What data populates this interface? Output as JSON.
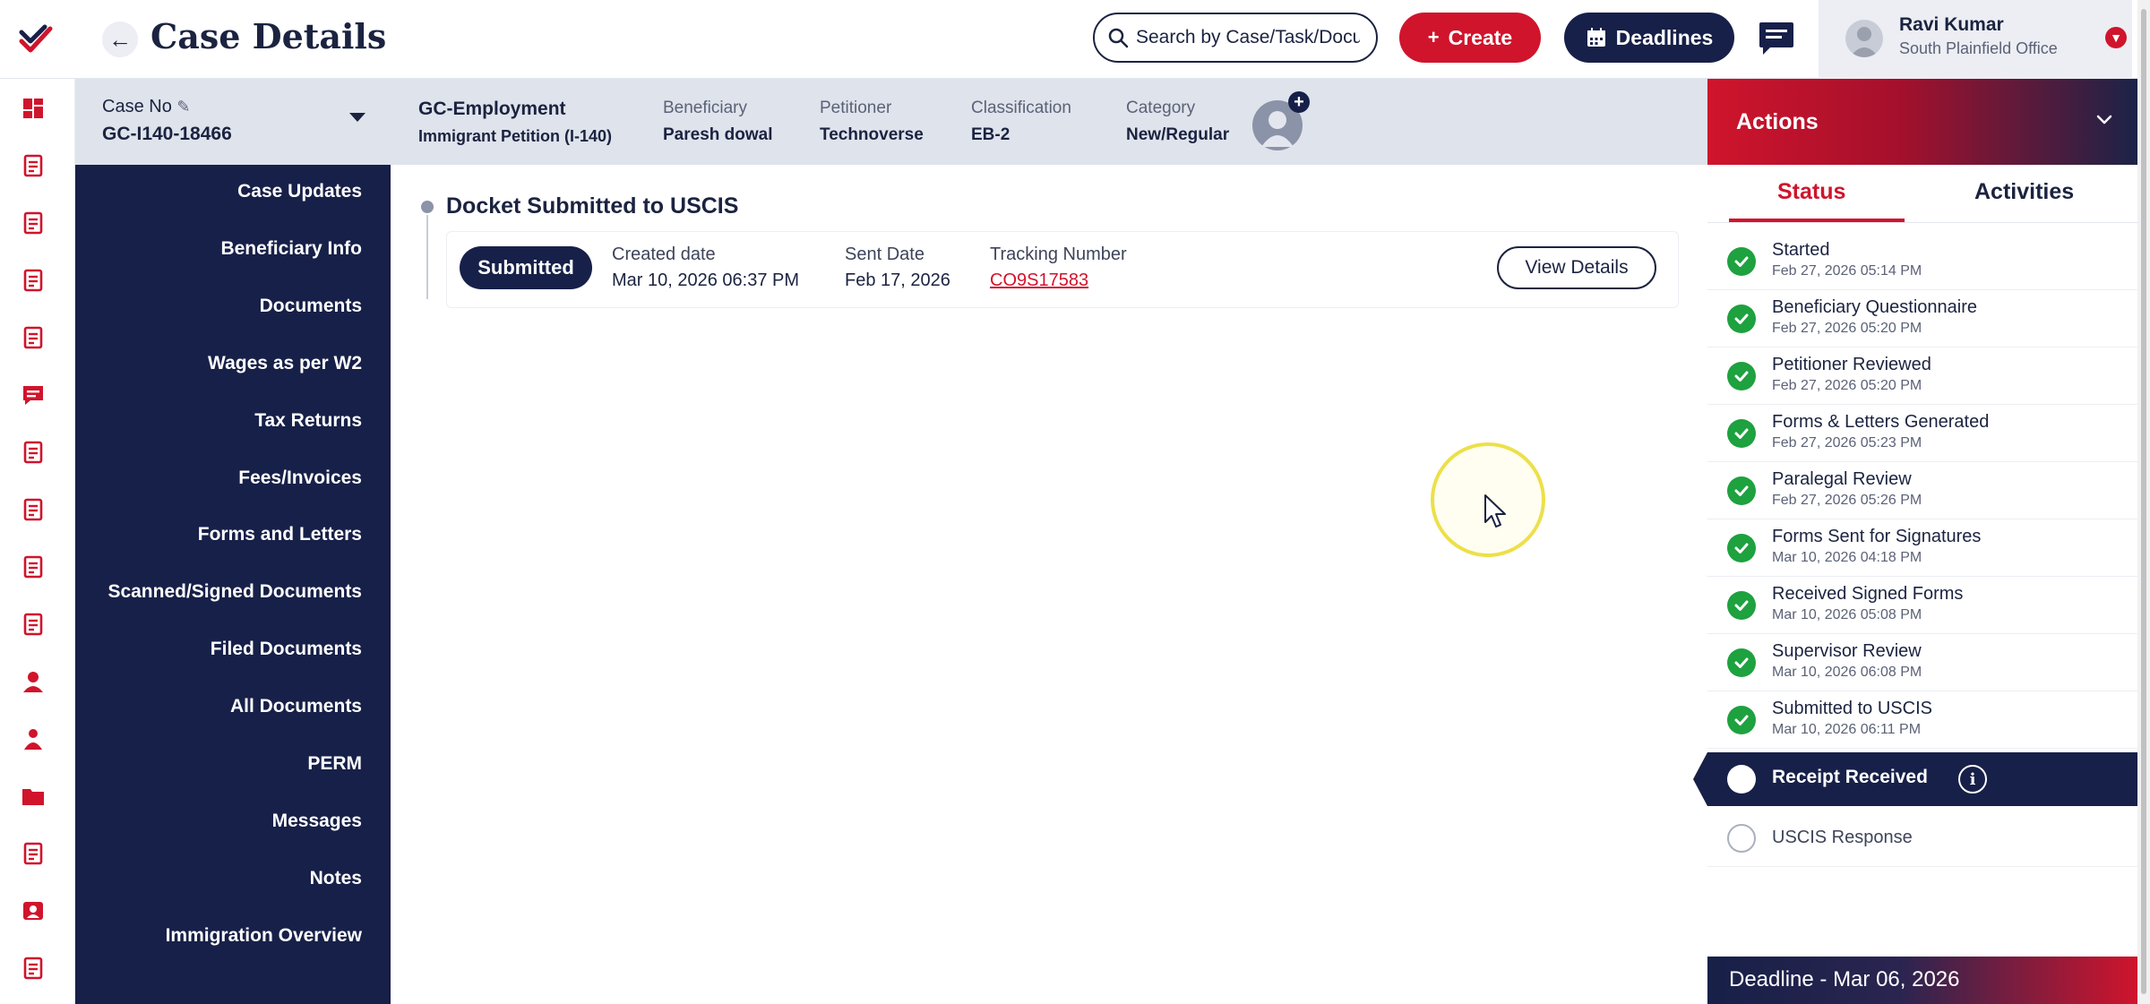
{
  "header": {
    "title": "Case Details",
    "search_placeholder": "Search by Case/Task/Docu",
    "create_label": "Create",
    "deadlines_label": "Deadlines",
    "user": {
      "name": "Ravi Kumar",
      "office": "South Plainfield Office"
    }
  },
  "case": {
    "case_no_label": "Case No",
    "case_no": "GC-I140-18466",
    "type": "GC-Employment",
    "subtype": "Immigrant Petition (I-140)",
    "fields": [
      {
        "label": "Beneficiary",
        "value": "Paresh dowal"
      },
      {
        "label": "Petitioner",
        "value": "Technoverse"
      },
      {
        "label": "Classification",
        "value": "EB-2"
      },
      {
        "label": "Category",
        "value": "New/Regular"
      }
    ]
  },
  "rail_icons": [
    "dashboard-icon",
    "document-icon",
    "case-icon",
    "building-icon",
    "report-icon",
    "message-icon",
    "form-icon",
    "edit-document-icon",
    "fees-icon",
    "clipboard-icon",
    "user-icon",
    "team-icon",
    "folder-icon",
    "note-icon",
    "profile-icon",
    "file-list-icon"
  ],
  "nav": {
    "items": [
      "Case Updates",
      "Beneficiary Info",
      "Documents",
      "Wages as per W2",
      "Tax Returns",
      "Fees/Invoices",
      "Forms and Letters",
      "Scanned/Signed Documents",
      "Filed Documents",
      "All Documents",
      "PERM",
      "Messages",
      "Notes",
      "Immigration Overview"
    ]
  },
  "docket": {
    "title": "Docket Submitted to USCIS",
    "status": "Submitted",
    "created_label": "Created date",
    "created_value": "Mar 10, 2026 06:37 PM",
    "sent_label": "Sent Date",
    "sent_value": "Feb 17, 2026",
    "tracking_label": "Tracking Number",
    "tracking_value": "CO9S17583",
    "view_label": "View Details"
  },
  "actions": {
    "title": "Actions",
    "tabs": [
      "Status",
      "Activities"
    ],
    "completed_steps": [
      {
        "name": "Started",
        "date": "Feb 27, 2026 05:14 PM"
      },
      {
        "name": "Beneficiary Questionnaire",
        "date": "Feb 27, 2026 05:20 PM"
      },
      {
        "name": "Petitioner Reviewed",
        "date": "Feb 27, 2026 05:20 PM"
      },
      {
        "name": "Forms & Letters Generated",
        "date": "Feb 27, 2026 05:23 PM"
      },
      {
        "name": "Paralegal Review",
        "date": "Feb 27, 2026 05:26 PM"
      },
      {
        "name": "Forms Sent for Signatures",
        "date": "Mar 10, 2026 04:18 PM"
      },
      {
        "name": "Received Signed Forms",
        "date": "Mar 10, 2026 05:08 PM"
      },
      {
        "name": "Supervisor Review",
        "date": "Mar 10, 2026 06:08 PM"
      },
      {
        "name": "Submitted to USCIS",
        "date": "Mar 10, 2026 06:11 PM"
      }
    ],
    "active_step": "Receipt Received",
    "pending_step": "USCIS Response",
    "deadline": "Deadline - Mar 06, 2026"
  },
  "colors": {
    "brand_red": "#d0142c",
    "navy": "#172048",
    "success": "#1ea13f"
  }
}
